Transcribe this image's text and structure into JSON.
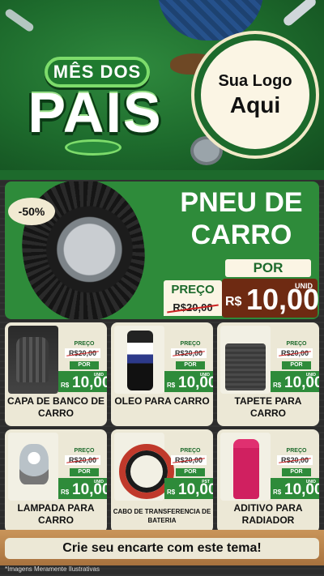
{
  "header": {
    "badge_top": "MÊS DOS",
    "badge_main": "PAIS",
    "logo_line1": "Sua Logo",
    "logo_line2": "Aqui"
  },
  "hero": {
    "discount": "-50%",
    "title": "PNEU DE CARRO",
    "por": "POR",
    "preco": "PREÇO",
    "old_price": "R$20,00",
    "unid": "UNID",
    "currency": "R$",
    "new_price": "10,00"
  },
  "products": [
    {
      "name": "CAPA DE BANCO DE CARRO",
      "preco": "PREÇO",
      "old_price": "R$20,00",
      "por": "POR",
      "currency": "R$",
      "new_price": "10,00",
      "unit": "UNID"
    },
    {
      "name": "OLEO PARA CARRO",
      "preco": "PREÇO",
      "old_price": "R$20,00",
      "por": "POR",
      "currency": "R$",
      "new_price": "10,00",
      "unit": "UNID"
    },
    {
      "name": "TAPETE PARA CARRO",
      "preco": "PREÇO",
      "old_price": "R$20,00",
      "por": "POR",
      "currency": "R$",
      "new_price": "10,00",
      "unit": "UNID"
    },
    {
      "name": "LAMPADA PARA CARRO",
      "preco": "PREÇO",
      "old_price": "R$20,00",
      "por": "POR",
      "currency": "R$",
      "new_price": "10,00",
      "unit": "UNID"
    },
    {
      "name": "CABO DE TRANSFERENCIA DE BATERIA",
      "preco": "PREÇO",
      "old_price": "R$20,00",
      "por": "POR",
      "currency": "R$",
      "new_price": "10,00",
      "unit": "PST"
    },
    {
      "name": "ADITIVO PARA RADIADOR",
      "preco": "PREÇO",
      "old_price": "R$20,00",
      "por": "POR",
      "currency": "R$",
      "new_price": "10,00",
      "unit": "UNID"
    }
  ],
  "footer": {
    "cta": "Crie seu encarte com este tema!",
    "disclaimer": "*Imagens Meramente Ilustrativas"
  },
  "colors": {
    "primary_green": "#2e8b3a",
    "dark_green": "#1d6a2c",
    "cream": "#ece8d6",
    "price_brown": "#6e2a12"
  }
}
